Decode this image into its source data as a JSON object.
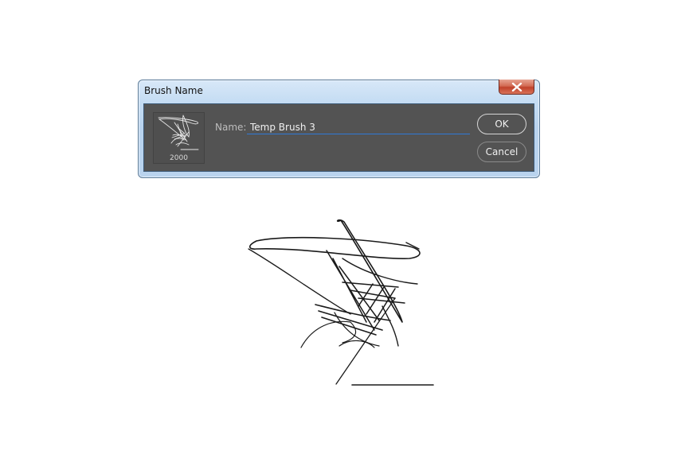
{
  "dialog": {
    "title": "Brush Name",
    "close_icon": "close-icon",
    "thumbnail_caption": "2000",
    "name_label": "Name:",
    "name_value": "Temp Brush 3",
    "ok_label": "OK",
    "cancel_label": "Cancel"
  },
  "colors": {
    "dialog_body": "#535353",
    "input_underline": "#2f7ad8",
    "close_button": "#c0412a",
    "title_bar": "#c4dcf3"
  },
  "canvas": {
    "preview_icon": "signature-brush-stroke"
  }
}
